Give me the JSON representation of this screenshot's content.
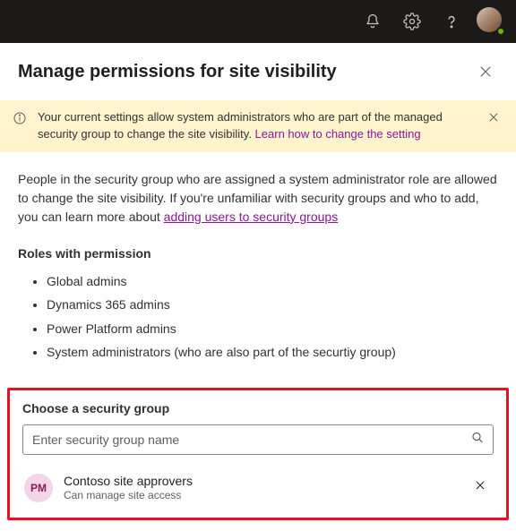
{
  "header": {
    "title": "Manage permissions for site visibility"
  },
  "banner": {
    "text": "Your current settings allow system administrators who are part of the managed security group to change the site visibility. ",
    "link": "Learn how to change the setting"
  },
  "description": {
    "text": "People in the security group who are assigned a system administrator role are allowed to change the site visibility. If you're unfamiliar with security groups and who to add, you can learn more about ",
    "link": "adding users to security groups"
  },
  "roles": {
    "heading": "Roles with permission",
    "items": [
      "Global admins",
      "Dynamics 365 admins",
      "Power Platform admins",
      "System administrators (who are also part of the securtiy group)"
    ]
  },
  "securityGroup": {
    "label": "Choose a security group",
    "placeholder": "Enter security group name",
    "selected": {
      "initials": "PM",
      "name": "Contoso site approvers",
      "description": "Can manage site access"
    }
  }
}
